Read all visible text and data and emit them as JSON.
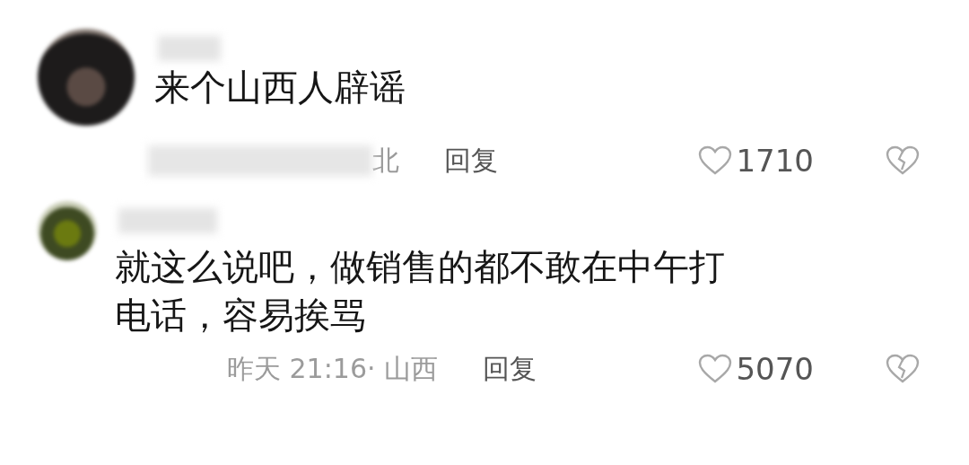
{
  "comments": [
    {
      "text": "来个山西人辟谣",
      "meta": "北",
      "meta_blurred": true,
      "reply": "回复",
      "likes": "1710",
      "replies": [
        {
          "text": "就这么说吧，做销售的都不敢在中午打电话，容易挨骂",
          "meta": "昨天 21:16· 山西",
          "reply": "回复",
          "likes": "5070"
        }
      ]
    }
  ]
}
